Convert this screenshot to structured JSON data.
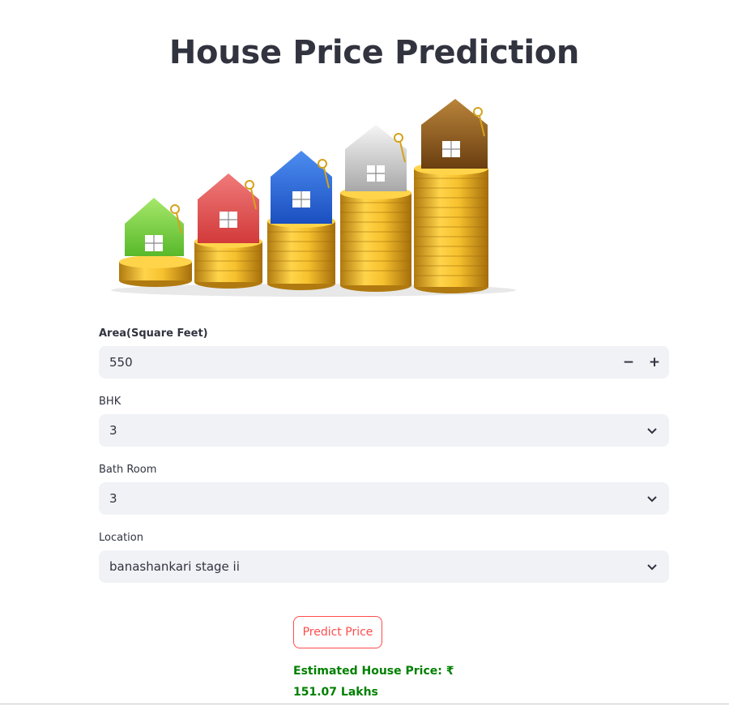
{
  "page": {
    "title": "House Price Prediction"
  },
  "hero": {
    "icon": "houses-on-coin-stacks-illustration"
  },
  "form": {
    "area": {
      "label": "Area(Square Feet)",
      "value": "550",
      "minus": "−",
      "plus": "+"
    },
    "bhk": {
      "label": "BHK",
      "value": "3"
    },
    "bath": {
      "label": "Bath Room",
      "value": "3"
    },
    "location": {
      "label": "Location",
      "value": "banashankari stage ii"
    }
  },
  "actions": {
    "predict_label": "Predict Price"
  },
  "result": {
    "line1": "Estimated House Price: ₹",
    "line2": "151.07 Lakhs",
    "color": "#008000"
  },
  "theme": {
    "accent": "#ff4b4b",
    "input_bg": "#f0f2f6",
    "text": "#31333f"
  }
}
